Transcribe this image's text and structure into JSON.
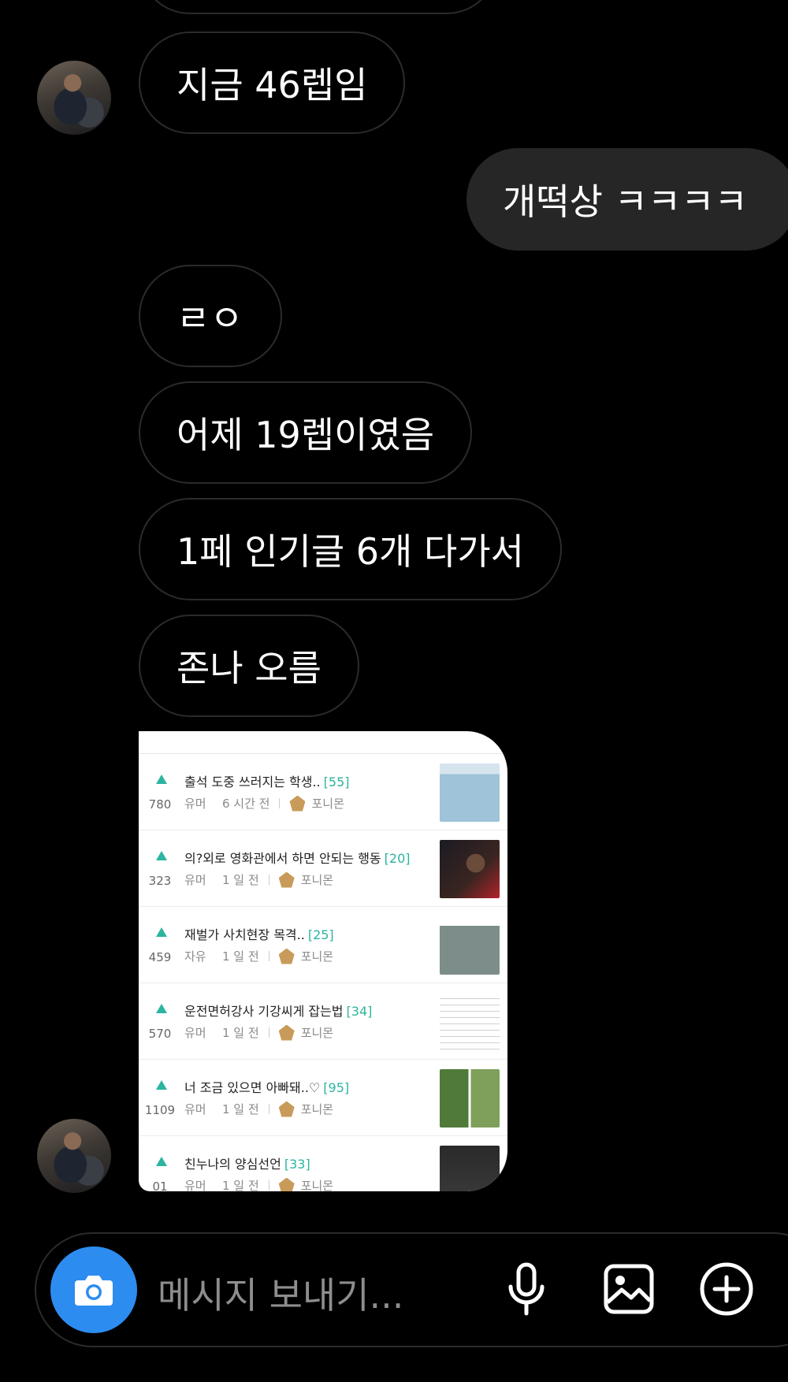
{
  "messages": [
    {
      "id": "m1",
      "text": "지금 46렙임",
      "side": "incoming"
    },
    {
      "id": "m2",
      "text": "개떡상 ㅋㅋㅋㅋ",
      "side": "outgoing"
    },
    {
      "id": "m3",
      "text": "ㄹㅇ",
      "side": "incoming"
    },
    {
      "id": "m4",
      "text": "어제 19렙이였음",
      "side": "incoming"
    },
    {
      "id": "m5",
      "text": "1페 인기글 6개 다가서",
      "side": "incoming"
    },
    {
      "id": "m6",
      "text": "존나 오름",
      "side": "incoming"
    }
  ],
  "shared_screenshot": {
    "posts": [
      {
        "title": "출석 도중 쓰러지는 학생..",
        "comments": "[55]",
        "votes": "780",
        "category": "유머",
        "time": "6 시간 전",
        "author": "포니몬"
      },
      {
        "title": "의?외로 영화관에서 하면 안되는 행동",
        "comments": "[20]",
        "votes": "323",
        "category": "유머",
        "time": "1 일 전",
        "author": "포니몬"
      },
      {
        "title": "재벌가 사치현장 목격..",
        "comments": "[25]",
        "votes": "459",
        "category": "자유",
        "time": "1 일 전",
        "author": "포니몬"
      },
      {
        "title": "운전면허강사 기강씨게 잡는법",
        "comments": "[34]",
        "votes": "570",
        "category": "유머",
        "time": "1 일 전",
        "author": "포니몬"
      },
      {
        "title": "너 조금 있으면 아빠돼..♡",
        "comments": "[95]",
        "votes": "1109",
        "category": "유머",
        "time": "1 일 전",
        "author": "포니몬"
      },
      {
        "title": "친누나의 양심선언",
        "comments": "[33]",
        "votes": "01",
        "category": "유머",
        "time": "1 일 전",
        "author": "포니몬"
      }
    ]
  },
  "composer": {
    "placeholder": "메시지 보내기...",
    "icons": [
      "camera-icon",
      "microphone-icon",
      "image-icon",
      "plus-circle-icon"
    ]
  },
  "colors": {
    "background": "#000000",
    "outgoing_bubble": "#262626",
    "incoming_border": "#2b2b2b",
    "camera_button": "#2d8cf0",
    "accent_green": "#2bb5a0",
    "placeholder_text": "#8e8e8e"
  }
}
